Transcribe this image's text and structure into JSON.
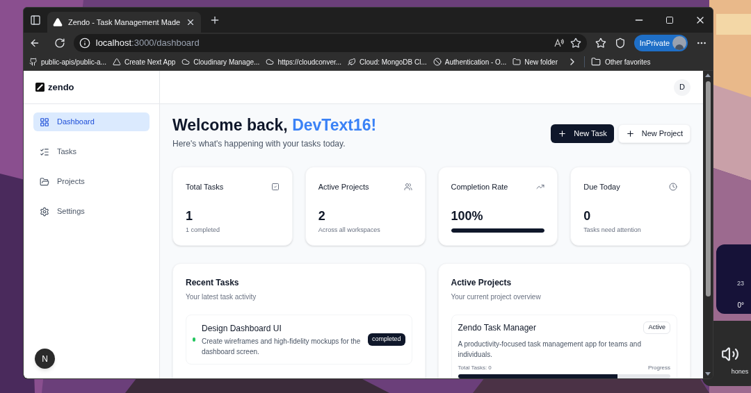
{
  "browser": {
    "tab_title": "Zendo - Task Management Made",
    "address": {
      "host": "localhost",
      "path": ":3000/dashboard"
    },
    "profile_label": "InPrivate",
    "bookmarks": [
      "public-apis/public-a...",
      "Create Next App",
      "Cloudinary Manage...",
      "https://cloudconver...",
      "Cloud: MongoDB Cl...",
      "Authentication - O...",
      "New folder"
    ],
    "other_favorites": "Other favorites"
  },
  "app": {
    "logo": "zendo",
    "avatar": "D",
    "dev_badge": "N",
    "nav": [
      {
        "label": "Dashboard",
        "selected": true
      },
      {
        "label": "Tasks",
        "selected": false
      },
      {
        "label": "Projects",
        "selected": false
      },
      {
        "label": "Settings",
        "selected": false
      }
    ],
    "welcome": {
      "greeting": "Welcome back, ",
      "name": "DevText16!",
      "subtitle": "Here's what's happening with your tasks today."
    },
    "actions": [
      {
        "label": "New Task",
        "kind": "primary"
      },
      {
        "label": "New Project",
        "kind": "secondary"
      }
    ],
    "stats": [
      {
        "title": "Total Tasks",
        "value": "1",
        "caption": "1 completed"
      },
      {
        "title": "Active Projects",
        "value": "2",
        "caption": "Across all workspaces"
      },
      {
        "title": "Completion Rate",
        "value": "100%",
        "level": 1
      },
      {
        "title": "Due Today",
        "value": "0",
        "caption": "Tasks need attention"
      }
    ],
    "recent_tasks": {
      "title": "Recent Tasks",
      "subtitle": "Your latest task activity",
      "tasks": [
        {
          "title": "Design Dashboard UI",
          "description": "Create wireframes and high-fidelity mockups for the dashboard screen.",
          "status": "completed",
          "color": "#22c55e"
        }
      ]
    },
    "active_projects": {
      "title": "Active Projects",
      "subtitle": "Your current project overview",
      "projects": [
        {
          "name": "Zendo Task Manager",
          "status": "Active",
          "description": "A productivity-focused task management app for teams and individuals.",
          "total_tasks": "Total Tasks: 0",
          "progress_label": "Progress",
          "level": 0.75
        }
      ]
    }
  },
  "desktop": {
    "weather_hour": "23",
    "weather_temp": "0°",
    "audio_label": "hones"
  }
}
